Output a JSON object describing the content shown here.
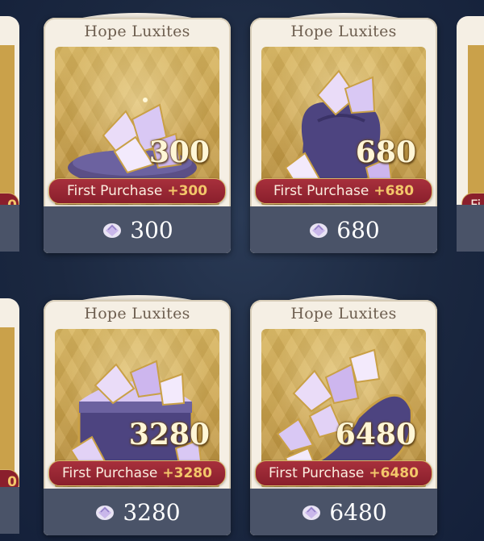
{
  "cards": [
    {
      "title": "Hope Luxites",
      "amount": "300",
      "ribbon_label": "First Purchase",
      "ribbon_bonus": "+300",
      "price": "300"
    },
    {
      "title": "Hope Luxites",
      "amount": "680",
      "ribbon_label": "First Purchase",
      "ribbon_bonus": "+680",
      "price": "680"
    },
    {
      "title": "Hope Luxites",
      "amount": "3280",
      "ribbon_label": "First Purchase",
      "ribbon_bonus": "+3280",
      "price": "3280"
    },
    {
      "title": "Hope Luxites",
      "amount": "6480",
      "ribbon_label": "First Purchase",
      "ribbon_bonus": "+6480",
      "price": "6480"
    }
  ],
  "peek_cards": [
    {
      "ribbon_fragment": "0"
    },
    {
      "ribbon_fragment": "Fi"
    },
    {
      "ribbon_fragment": "0"
    }
  ],
  "colors": {
    "background": "#1b2840",
    "card_frame": "#f5efe4",
    "title_text": "#6d5e4f",
    "art_gold": "#caa14a",
    "ribbon_red": "#8a1f2c",
    "ribbon_bonus_gold": "#f3c76a",
    "footer_slate": "#4a5368"
  },
  "icons": {
    "price_currency": "luxite-gem-icon",
    "art": "crystal-pile-icon"
  }
}
